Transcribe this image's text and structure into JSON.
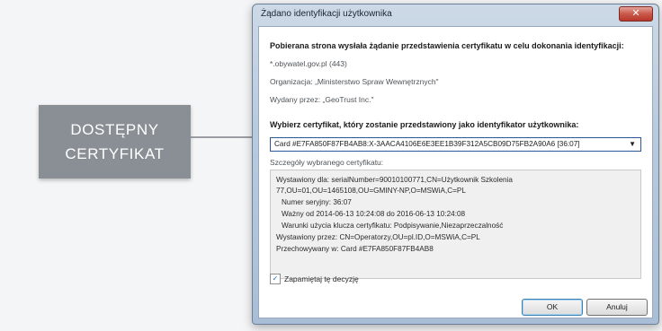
{
  "callout": {
    "line1": "DOSTĘPNY",
    "line2": "CERTYFIKAT"
  },
  "dialog": {
    "title": "Żądano identyfikacji użytkownika",
    "close_label": "✕",
    "intro": "Pobierana strona wysłała żądanie przedstawienia certyfikatu w celu dokonania identyfikacji:",
    "site": "*.obywatel.gov.pl (443)",
    "organization": "Organizacja: „Ministerstwo Spraw Wewnętrznych\"",
    "issued_by": "Wydany przez: „GeoTrust Inc.\"",
    "choose_label": "Wybierz certyfikat, który zostanie przedstawiony jako identyfikator użytkownika:",
    "selected_certificate": "Card #E7FA850F87FB4AB8:X-3AACA4106E6E3EE1B39F312A5CB09D75FB2A90A6 [36:07]",
    "details_label": "Szczegóły wybranego certyfikatu:",
    "details": [
      "Wystawiony dla: serialNumber=90010100771,CN=Użytkownik Szkolenia",
      "77,OU=01,OU=1465108,OU=GMINY-NP,O=MSWiA,C=PL",
      "Numer seryjny: 36:07",
      "Ważny od 2014-06-13 10:24:08 do 2016-06-13 10:24:08",
      "Warunki użycia klucza certyfikatu: Podpisywanie,Niezaprzeczalność",
      "Wystawiony przez: CN=Operatorzy,OU=pl.ID,O=MSWiA,C=PL",
      "Przechowywany w: Card #E7FA850F87FB4AB8"
    ],
    "remember_label": "Zapamiętaj tę decyzję",
    "remember_checked": "✓",
    "ok_label": "OK",
    "cancel_label": "Anuluj"
  }
}
